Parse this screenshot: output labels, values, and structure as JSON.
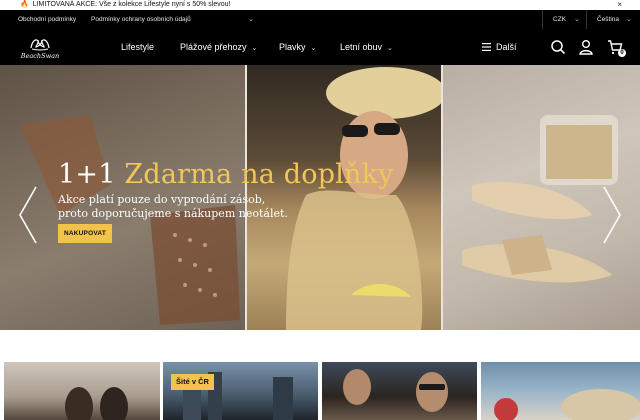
{
  "announcement": {
    "icon": "fire-icon",
    "text": "LIMITOVANÁ AKCE: Vše z kolekce Lifestyle nyní s 50% slevou!",
    "close": "×"
  },
  "utility": {
    "links": [
      "Obchodní podmínky",
      "Podmínky ochrany osobních údajů"
    ],
    "currency": "CZK",
    "language": "Čeština"
  },
  "nav": {
    "logo_text": "BeachSwan",
    "items": [
      {
        "label": "Lifestyle",
        "dropdown": false
      },
      {
        "label": "Plážové přehozy",
        "dropdown": true
      },
      {
        "label": "Plavky",
        "dropdown": true
      },
      {
        "label": "Letní obuv",
        "dropdown": true
      }
    ],
    "more_label": "Další",
    "cart_count": "0"
  },
  "hero": {
    "title_prefix": "1+1 ",
    "title_accent": "Zdarma na doplňky",
    "subtitle": "Akce platí pouze do vyprodání zásob, proto doporučujeme s nákupem neotálet.",
    "cta": "NAKUPOVAT"
  },
  "tiles": {
    "badge": "Šité v ČR"
  },
  "colors": {
    "accent": "#f1c24c",
    "header_bg": "#000000",
    "title_accent": "#f1c75a"
  }
}
